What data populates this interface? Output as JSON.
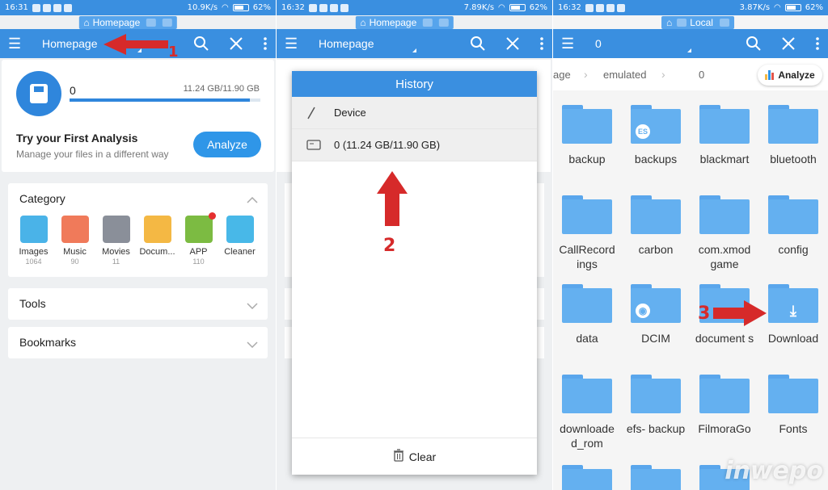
{
  "panels": [
    {
      "status": {
        "time": "16:31",
        "speed": "10.9K/s",
        "battery": "62%"
      },
      "tab_pill": "Homepage",
      "toolbar_title": "Homepage"
    },
    {
      "status": {
        "time": "16:32",
        "speed": "7.89K/s",
        "battery": "62%"
      },
      "tab_pill": "Homepage",
      "toolbar_title": "Homepage"
    },
    {
      "status": {
        "time": "16:32",
        "speed": "3.87K/s",
        "battery": "62%"
      },
      "tab_pill": "Local",
      "toolbar_title": "0"
    }
  ],
  "homepage": {
    "storage": {
      "name": "0",
      "usage": "11.24 GB/11.90 GB",
      "fill_fraction": 0.944
    },
    "analysis": {
      "title": "Try your First Analysis",
      "subtitle": "Manage your files in a different way",
      "button": "Analyze"
    },
    "category": {
      "title": "Category",
      "items": [
        {
          "label": "Images",
          "count": "1064",
          "color": "#4ab3e8"
        },
        {
          "label": "Music",
          "count": "90",
          "color": "#f07a5a"
        },
        {
          "label": "Movies",
          "count": "11",
          "color": "#8a8f99"
        },
        {
          "label": "Docum...",
          "count": "",
          "color": "#f4b844"
        },
        {
          "label": "APP",
          "count": "110",
          "color": "#7cbb42"
        },
        {
          "label": "Cleaner",
          "count": "",
          "color": "#48b8e8"
        }
      ]
    },
    "tools_label": "Tools",
    "bookmarks_label": "Bookmarks"
  },
  "history": {
    "title": "History",
    "rows": [
      {
        "label": "Device",
        "icon": "slash-icon"
      },
      {
        "label": "0 (11.24 GB/11.90 GB)",
        "icon": "sd-card-icon"
      }
    ],
    "clear_label": "Clear"
  },
  "local": {
    "breadcrumbs": [
      "age",
      "emulated",
      "0"
    ],
    "analyze_label": "Analyze",
    "folders": [
      "backup",
      "backups",
      "blackmart",
      "bluetooth",
      "CallRecord ings",
      "carbon",
      "com.xmod game",
      "config",
      "data",
      "DCIM",
      "document s",
      "Download",
      "downloade d_rom",
      "efs- backup",
      "FilmoraGo",
      "Fonts"
    ]
  },
  "annotations": {
    "step1": "1",
    "step2": "2",
    "step3": "3",
    "arrow_color": "#d62a2a"
  },
  "watermark": "inwepo"
}
